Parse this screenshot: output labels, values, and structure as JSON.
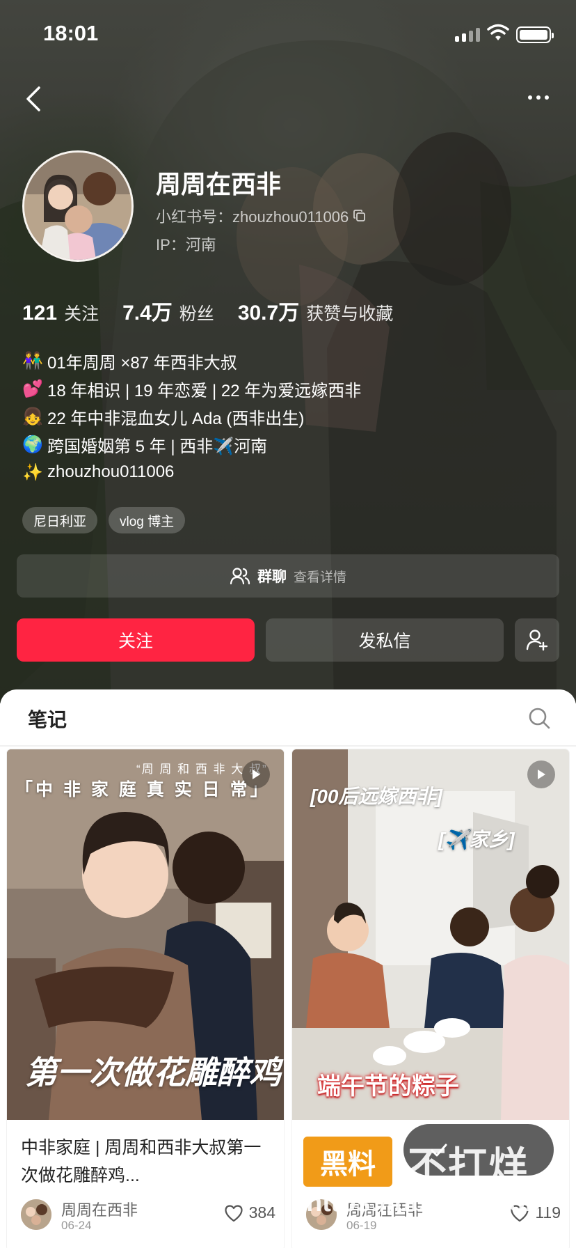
{
  "status_bar": {
    "time": "18:01"
  },
  "profile": {
    "nickname": "周周在西非",
    "red_id": "小红书号：zhouzhou011006",
    "ip": "IP：河南"
  },
  "stats": [
    {
      "num": "121",
      "label": "关注"
    },
    {
      "num": "7.4万",
      "label": "粉丝"
    },
    {
      "num": "30.7万",
      "label": "获赞与收藏"
    }
  ],
  "bio": [
    {
      "emoji": "👫",
      "text": "01年周周 ×87 年西非大叔"
    },
    {
      "emoji": "💕",
      "text": "18 年相识 | 19 年恋爱 | 22 年为爱远嫁西非"
    },
    {
      "emoji": "👧",
      "text": "22 年中非混血女儿 Ada (西非出生)"
    },
    {
      "emoji": "🌍",
      "text": "跨国婚姻第 5 年 | 西非✈️河南"
    },
    {
      "emoji": "✨",
      "text": "zhouzhou011006"
    }
  ],
  "tags": [
    "尼日利亚",
    "vlog 博主"
  ],
  "group_chat": {
    "title": "群聊",
    "subtitle": "查看详情"
  },
  "buttons": {
    "follow": "关注",
    "message": "发私信"
  },
  "tabs": {
    "notes": "笔记"
  },
  "notes": [
    {
      "title": "中非家庭 | 周周和西非大叔第一次做花雕醉鸡...",
      "author": "周周在西非",
      "date": "06-24",
      "likes": "384",
      "cover_top": "「中 非 家 庭 真 实 日 常」",
      "cover_corner": "“周 周 和 西 非 大 叔”",
      "cover_caption": "第一次做花雕醉鸡"
    },
    {
      "title": "",
      "author": "周周在西非",
      "date": "06-19",
      "likes": "119",
      "cover_top": "[00后远嫁西非]",
      "cover_sub": "[✈️家乡]",
      "cover_caption": "端午节的粽子"
    }
  ],
  "watermark": {
    "badge": "黑料",
    "text": "不打烊",
    "url": "https://bbdy31.com"
  },
  "colors": {
    "accent": "#ff2442"
  }
}
